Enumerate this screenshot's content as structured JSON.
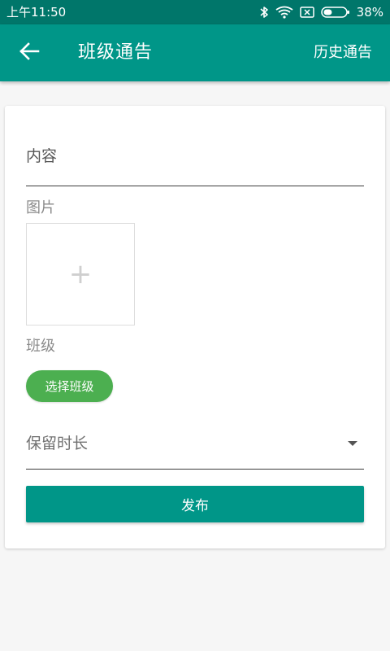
{
  "status_bar": {
    "time": "上午11:50",
    "battery_percent": "38%",
    "icons": [
      "bluetooth-icon",
      "wifi-icon",
      "sim-blocked-icon",
      "battery-icon"
    ],
    "battery_level": 0.38,
    "background": "#00766a"
  },
  "app_bar": {
    "back_icon": "arrow-left-icon",
    "title": "班级通告",
    "history_label": "历史通告",
    "background": "#009688"
  },
  "form": {
    "content_placeholder": "内容",
    "image_label": "图片",
    "add_image_icon": "plus-icon",
    "add_image_glyph": "+",
    "class_label": "班级",
    "select_class_label": "选择班级",
    "select_class_color": "#4caf50",
    "duration_placeholder": "保留时长",
    "duration_icon": "dropdown-arrow-icon",
    "publish_label": "发布",
    "publish_color": "#009688"
  }
}
